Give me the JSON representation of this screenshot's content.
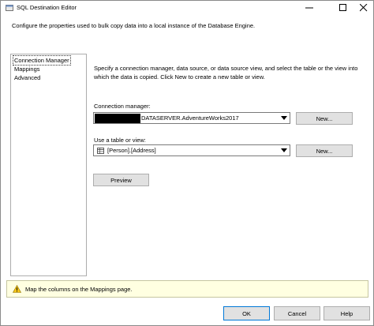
{
  "window": {
    "title": "SQL Destination Editor",
    "description": "Configure the properties used to bulk copy data into a local instance of the Database Engine."
  },
  "nav": {
    "items": [
      {
        "label": "Connection Manager",
        "selected": true
      },
      {
        "label": "Mappings",
        "selected": false
      },
      {
        "label": "Advanced",
        "selected": false
      }
    ]
  },
  "main": {
    "instructions": "Specify a connection manager, data source, or data source view, and select the table or the view into which the data is copied. Click New to create a new table or view.",
    "connection_label": "Connection manager:",
    "connection_value": "DATASERVER.AdventureWorks2017",
    "connection_new": "New...",
    "table_label": "Use a table or view:",
    "table_value": "[Person].[Address]",
    "table_new": "New...",
    "preview": "Preview"
  },
  "message": {
    "text": "Map the columns on the Mappings page."
  },
  "footer": {
    "ok": "OK",
    "cancel": "Cancel",
    "help": "Help"
  },
  "colors": {
    "accent": "#0078d7",
    "message_bg": "#ffffe1",
    "button_bg": "#e1e1e1"
  }
}
